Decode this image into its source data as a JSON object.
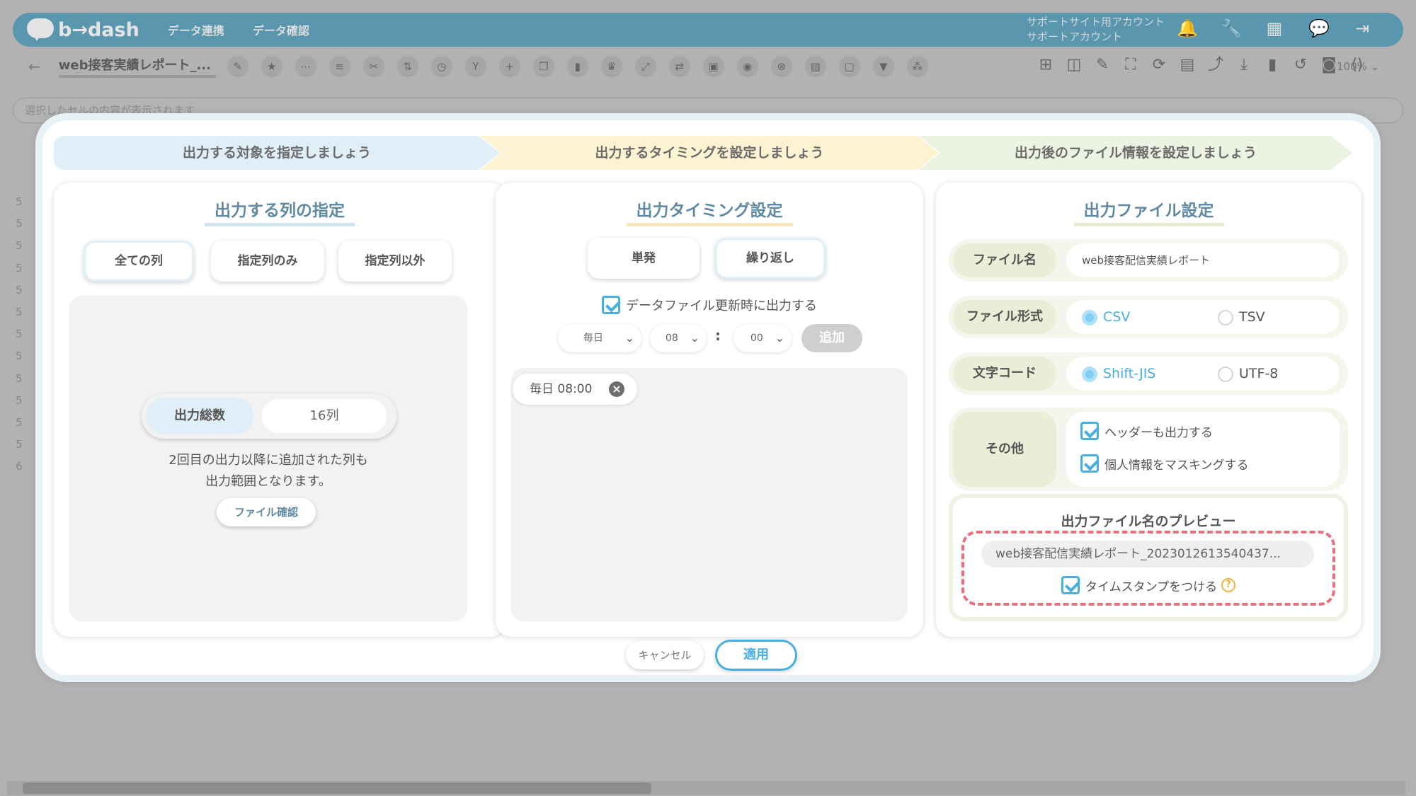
{
  "app": {
    "brand": "b→dash",
    "nav": [
      "データ連携",
      "データ確認"
    ],
    "account_line1": "サポートサイト用アカウント",
    "account_line2": "サポートアカウント"
  },
  "toolbar": {
    "doc_title": "web接客実績レポート_...",
    "zoom": "100%"
  },
  "formula_bar": {
    "placeholder": "選択したセルの内容が表示されます"
  },
  "row_numbers": [
    "5",
    "5",
    "5",
    "5",
    "5",
    "5",
    "5",
    "5",
    "5",
    "5",
    "5",
    "5",
    "6"
  ],
  "steps": [
    "出力する対象を指定しましょう",
    "出力するタイミングを設定しましょう",
    "出力後のファイル情報を設定しましょう"
  ],
  "columns_panel": {
    "title": "出力する列の指定",
    "options": [
      "全ての列",
      "指定列のみ",
      "指定列以外"
    ],
    "selected": "全ての列",
    "count_label": "出力総数",
    "count_value": "16列",
    "note_line1": "2回目の出力以降に追加された列も",
    "note_line2": "出力範囲となります。",
    "file_check_button": "ファイル確認"
  },
  "timing_panel": {
    "title": "出力タイミング設定",
    "modes": [
      "単発",
      "繰り返し"
    ],
    "selected_mode": "繰り返し",
    "trigger_label": "データファイル更新時に出力する",
    "trigger_checked": true,
    "frequency": "毎日",
    "hour": "08",
    "minute": "00",
    "colon": ":",
    "add_button": "追加",
    "schedules": [
      "毎日 08:00"
    ]
  },
  "file_panel": {
    "title": "出力ファイル設定",
    "filename_label": "ファイル名",
    "filename_value": "web接客配信実績レポート",
    "format_label": "ファイル形式",
    "format_options": [
      "CSV",
      "TSV"
    ],
    "format_selected": "CSV",
    "encoding_label": "文字コード",
    "encoding_options": [
      "Shift-JIS",
      "UTF-8"
    ],
    "encoding_selected": "Shift-JIS",
    "other_label": "その他",
    "other_options": [
      {
        "label": "ヘッダーも出力する",
        "checked": true
      },
      {
        "label": "個人情報をマスキングする",
        "checked": true
      }
    ],
    "preview_title": "出力ファイル名のプレビュー",
    "preview_filename": "web接客配信実績レポート_2023012613540437...",
    "timestamp_label": "タイムスタンプをつける",
    "timestamp_checked": true
  },
  "footer": {
    "cancel": "キャンセル",
    "apply": "適用"
  },
  "colors": {
    "accent": "#49aee0",
    "title_blue": "#5f8aa1",
    "highlight_red": "#e86f7c"
  }
}
